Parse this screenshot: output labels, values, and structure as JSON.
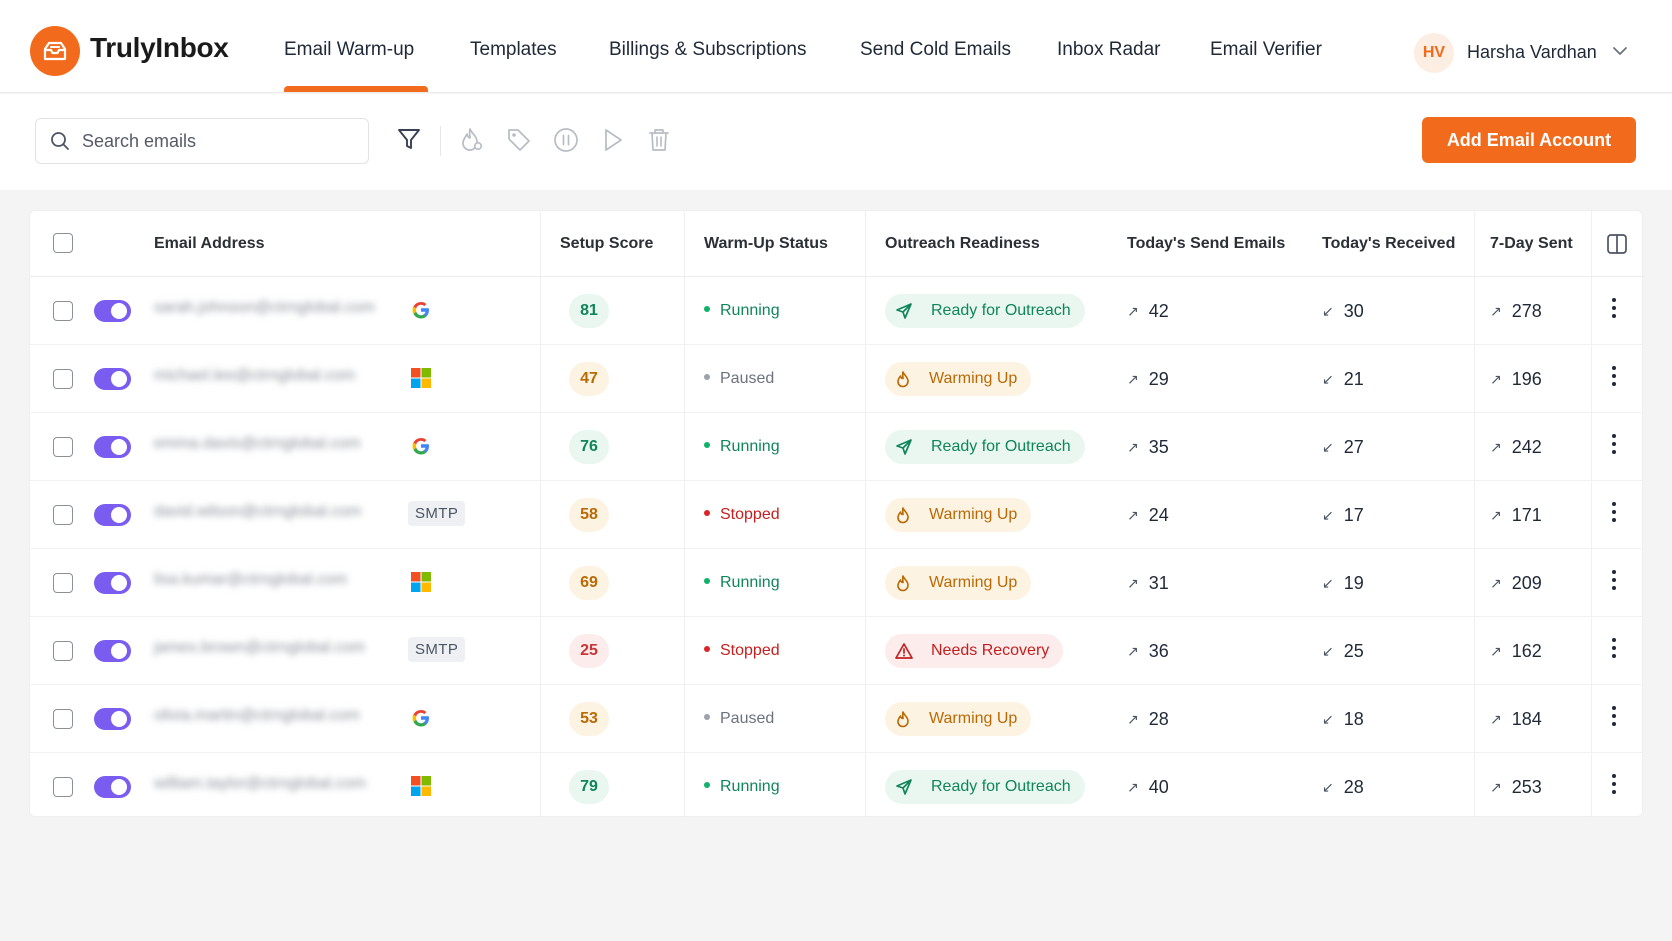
{
  "app": {
    "name": "TrulyInbox"
  },
  "nav": {
    "tabs": [
      {
        "label": "Email Warm-up",
        "active": true
      },
      {
        "label": "Templates"
      },
      {
        "label": "Billings & Subscriptions"
      },
      {
        "label": "Send Cold Emails"
      },
      {
        "label": "Inbox Radar"
      },
      {
        "label": "Email Verifier"
      }
    ]
  },
  "user": {
    "initials": "HV",
    "name": "Harsha Vardhan"
  },
  "toolbar": {
    "search_placeholder": "Search emails",
    "add_label": "Add Email Account"
  },
  "colors": {
    "brand": "#f26b1d",
    "toggle": "#7b5cf0",
    "running": "#10855a",
    "stopped": "#c31f1f",
    "warming": "#b96a05"
  },
  "table": {
    "headers": {
      "email": "Email Address",
      "score": "Setup Score",
      "status": "Warm-Up Status",
      "readiness": "Outreach Readiness",
      "sent_today": "Today's Send Emails",
      "received_today": "Today's Received",
      "sent_7d": "7-Day Sent"
    },
    "rows": [
      {
        "email": "sarah.johnson@ctrnglobal.com",
        "provider": "google",
        "score": "81",
        "score_tone": "green",
        "status": "Running",
        "status_tone": "running",
        "readiness": "Ready for Outreach",
        "readiness_tone": "green",
        "readiness_icon": "send-icon",
        "sent_today": "42",
        "received_today": "30",
        "sent_7d": "278"
      },
      {
        "email": "michael.lee@ctrnglobal.com",
        "provider": "microsoft",
        "score": "47",
        "score_tone": "amber",
        "status": "Paused",
        "status_tone": "paused",
        "readiness": "Warming Up",
        "readiness_tone": "amber",
        "readiness_icon": "flame-icon",
        "sent_today": "29",
        "received_today": "21",
        "sent_7d": "196"
      },
      {
        "email": "emma.davis@ctrnglobal.com",
        "provider": "google",
        "score": "76",
        "score_tone": "green",
        "status": "Running",
        "status_tone": "running",
        "readiness": "Ready for Outreach",
        "readiness_tone": "green",
        "readiness_icon": "send-icon",
        "sent_today": "35",
        "received_today": "27",
        "sent_7d": "242"
      },
      {
        "email": "david.wilson@ctrnglobal.com",
        "provider": "smtp",
        "provider_label": "SMTP",
        "score": "58",
        "score_tone": "amber",
        "status": "Stopped",
        "status_tone": "stopped",
        "readiness": "Warming Up",
        "readiness_tone": "amber",
        "readiness_icon": "flame-icon",
        "sent_today": "24",
        "received_today": "17",
        "sent_7d": "171"
      },
      {
        "email": "lisa.kumar@ctrnglobal.com",
        "provider": "microsoft",
        "score": "69",
        "score_tone": "amber",
        "status": "Running",
        "status_tone": "running",
        "readiness": "Warming Up",
        "readiness_tone": "amber",
        "readiness_icon": "flame-icon",
        "sent_today": "31",
        "received_today": "19",
        "sent_7d": "209"
      },
      {
        "email": "james.brown@ctrnglobal.com",
        "provider": "smtp",
        "provider_label": "SMTP",
        "score": "25",
        "score_tone": "red",
        "status": "Stopped",
        "status_tone": "stopped",
        "readiness": "Needs Recovery",
        "readiness_tone": "red",
        "readiness_icon": "warning-icon",
        "sent_today": "36",
        "received_today": "25",
        "sent_7d": "162"
      },
      {
        "email": "olivia.martin@ctrnglobal.com",
        "provider": "google",
        "score": "53",
        "score_tone": "amber",
        "status": "Paused",
        "status_tone": "paused",
        "readiness": "Warming Up",
        "readiness_tone": "amber",
        "readiness_icon": "flame-icon",
        "sent_today": "28",
        "received_today": "18",
        "sent_7d": "184"
      },
      {
        "email": "william.taylor@ctrnglobal.com",
        "provider": "microsoft",
        "score": "79",
        "score_tone": "green",
        "status": "Running",
        "status_tone": "running",
        "readiness": "Ready for Outreach",
        "readiness_tone": "green",
        "readiness_icon": "send-icon",
        "sent_today": "40",
        "received_today": "28",
        "sent_7d": "253"
      }
    ]
  }
}
